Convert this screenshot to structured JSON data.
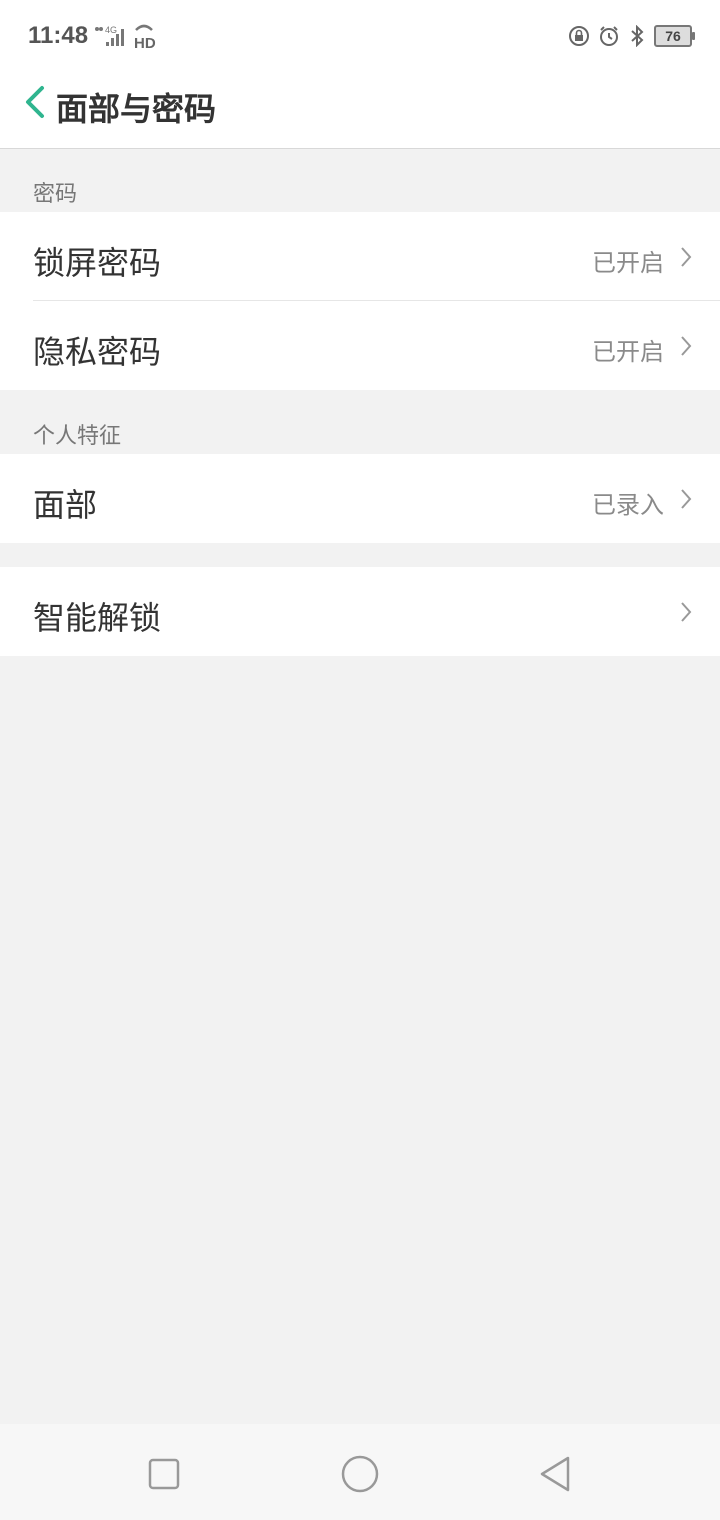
{
  "status_bar": {
    "time": "11:48",
    "network": "4G",
    "hd": "HD",
    "battery": "76"
  },
  "header": {
    "title": "面部与密码",
    "accent_color": "#2fb58f"
  },
  "sections": [
    {
      "label": "密码",
      "items": [
        {
          "label": "锁屏密码",
          "value": "已开启"
        },
        {
          "label": "隐私密码",
          "value": "已开启"
        }
      ]
    },
    {
      "label": "个人特征",
      "items": [
        {
          "label": "面部",
          "value": "已录入"
        }
      ]
    },
    {
      "label": "",
      "items": [
        {
          "label": "智能解锁",
          "value": ""
        }
      ]
    }
  ],
  "nav": {
    "icons": [
      "square-icon",
      "circle-icon",
      "triangle-back-icon"
    ]
  }
}
